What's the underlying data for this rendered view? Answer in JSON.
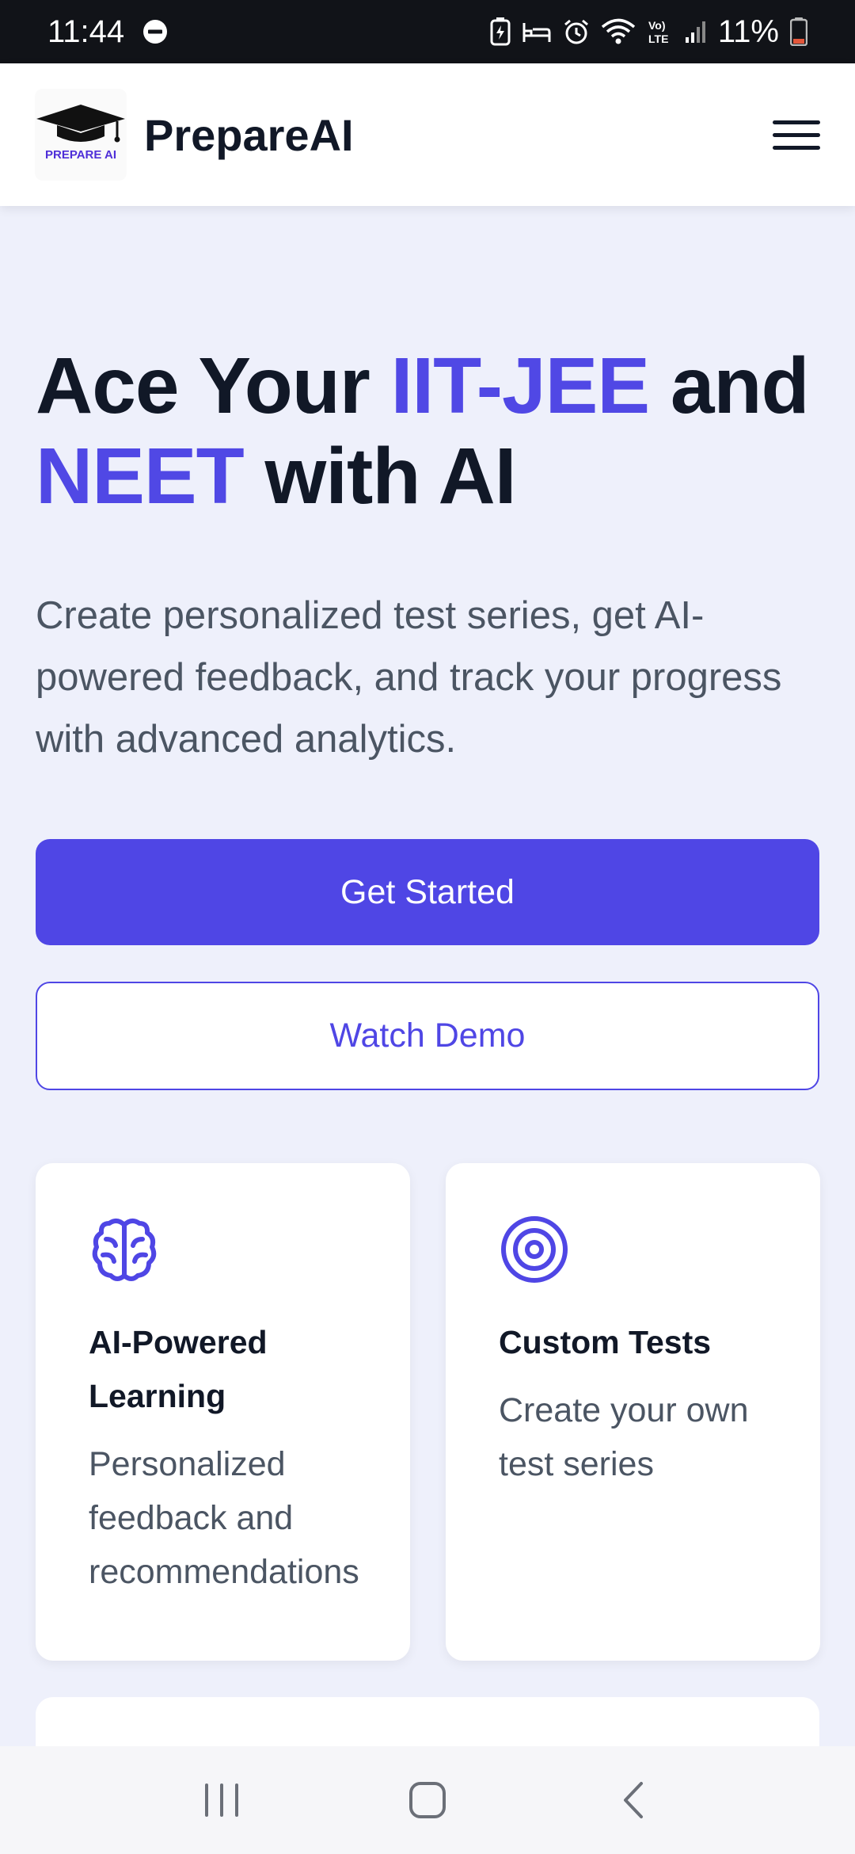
{
  "status_bar": {
    "time": "11:44",
    "battery": "11%",
    "icons": [
      "do-not-disturb-icon",
      "battery-saver-icon",
      "sleep-mode-icon",
      "alarm-icon",
      "wifi-icon",
      "volte-icon",
      "signal-icon",
      "battery-icon"
    ]
  },
  "header": {
    "logo_caption": "PREPARE AI",
    "brand": "PrepareAI",
    "menu_icon": "hamburger-menu-icon"
  },
  "hero": {
    "title_part1": "Ace Your ",
    "title_accent1": "IIT-JEE",
    "title_part2": " and ",
    "title_accent2": "NEET",
    "title_part3": " with AI",
    "description": "Create personalized test series, get AI-powered feedback, and track your progress with advanced analytics.",
    "primary_button": "Get Started",
    "secondary_button": "Watch Demo"
  },
  "features": [
    {
      "icon": "brain-icon",
      "title": "AI-Powered Learning",
      "description": "Personalized feedback and recommendations"
    },
    {
      "icon": "target-icon",
      "title": "Custom Tests",
      "description": "Create your own test series"
    }
  ],
  "nav_bar": {
    "icons": [
      "recent-apps-icon",
      "home-icon",
      "back-icon"
    ]
  },
  "colors": {
    "accent": "#4f46e5",
    "accent_text": "#5048e5",
    "background": "#eef0fb",
    "status_bar": "#111318",
    "heading": "#111827",
    "body_text": "#4b5563"
  }
}
